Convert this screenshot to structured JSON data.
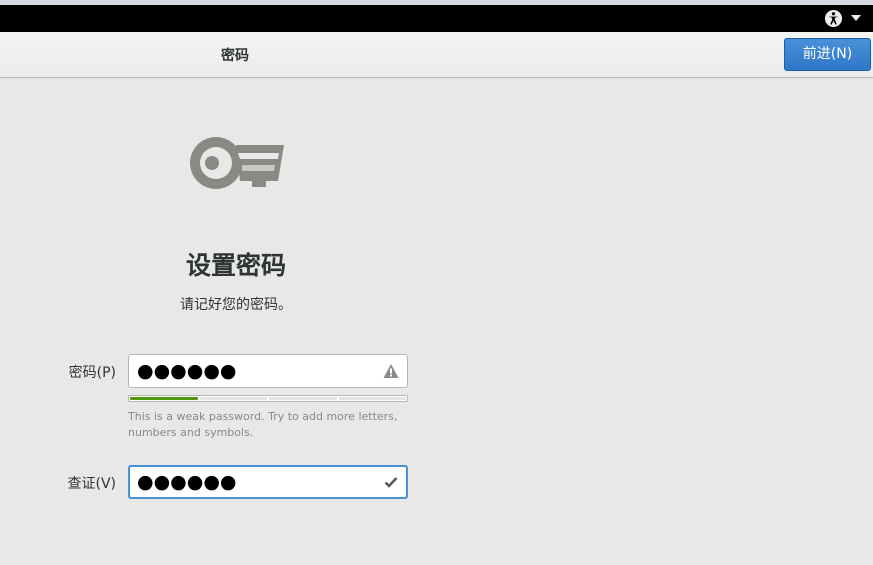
{
  "topbar": {
    "accessibility_icon": "accessibility-icon",
    "menu_icon": "caret-down-icon"
  },
  "header": {
    "title": "密码",
    "next_label": "前进(N)"
  },
  "main": {
    "icon": "key-icon",
    "heading": "设置密码",
    "subheading": "请记好您的密码。",
    "password": {
      "label": "密码(P)",
      "value": "●●●●●●",
      "status_icon": "warning-icon"
    },
    "strength": {
      "level": 0.25,
      "hint": "This is a weak password. Try to add more letters, numbers and symbols."
    },
    "confirm": {
      "label": "查证(V)",
      "value": "●●●●●●",
      "status_icon": "checkmark-icon"
    }
  },
  "colors": {
    "accent": "#4a90d9",
    "strength_fill": "#4e9a06",
    "background": "#e8e8e7"
  }
}
